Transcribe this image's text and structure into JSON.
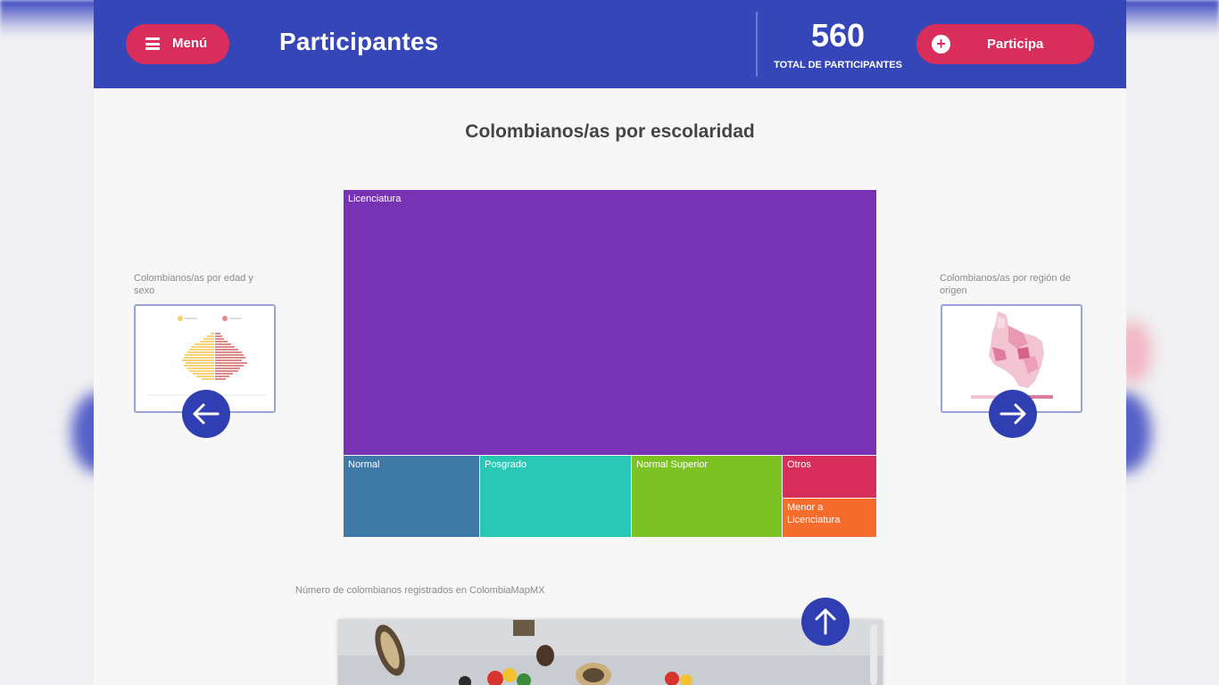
{
  "header": {
    "menu_label": "Menú",
    "title": "Participantes",
    "total_count": "560",
    "total_label": "TOTAL DE PARTICIPANTES",
    "participa_label": "Participa"
  },
  "section_title": "Colombianos/as por escolaridad",
  "chart_data": {
    "type": "treemap",
    "title": "Colombianos/as por escolaridad",
    "categories": [
      "Licenciatura",
      "Normal",
      "Posgrado",
      "Normal Superior",
      "Otros",
      "Menor a Licenciatura"
    ],
    "values": [
      427,
      37,
      41,
      40,
      7,
      6
    ],
    "colors": [
      "#7733b3",
      "#3f7aa6",
      "#28c8b4",
      "#7cc223",
      "#d92d5c",
      "#f56c2c"
    ]
  },
  "prev": {
    "label": "Colombianos/as por edad y sexo"
  },
  "next": {
    "label": "Colombianos/as por región de origen"
  },
  "bottom_label": "Número de colombianos registrados en ColombiaMapMX",
  "icons": {
    "menu": "hamburger-icon",
    "participa": "plus-circle-icon",
    "prev": "arrow-left-icon",
    "next": "arrow-right-icon",
    "top": "arrow-up-icon"
  }
}
